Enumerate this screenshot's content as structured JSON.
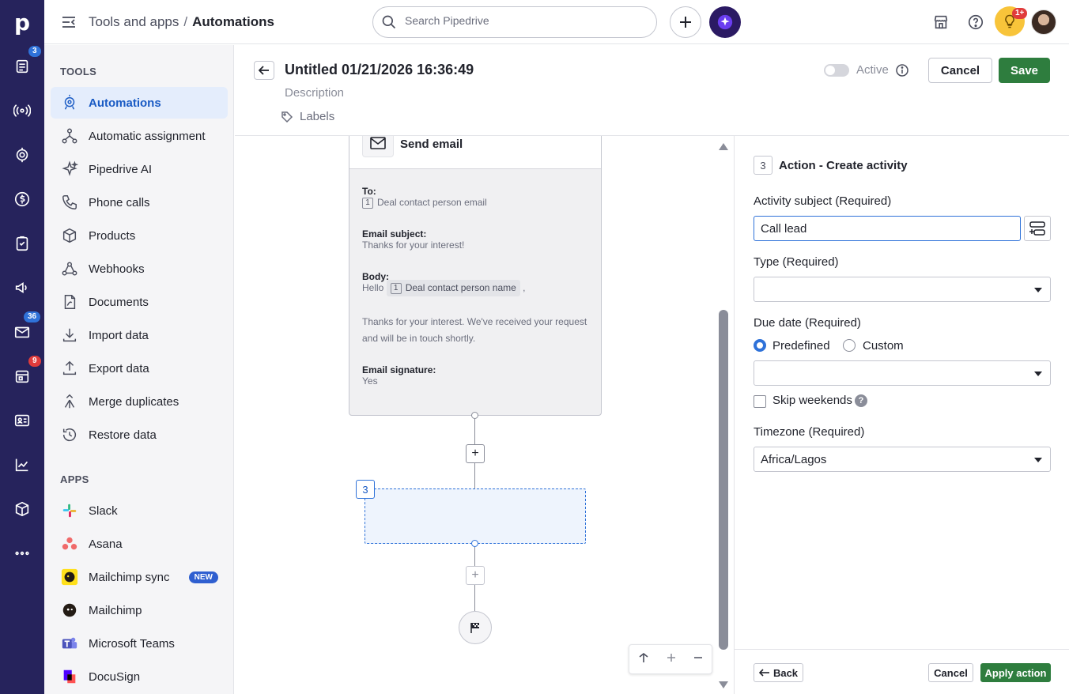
{
  "rail": {
    "logo": "p",
    "badges": {
      "leads": "3",
      "mail": "36",
      "calendar": "9"
    }
  },
  "topbar": {
    "breadcrumb_parent": "Tools and apps",
    "breadcrumb_separator": "/",
    "breadcrumb_current": "Automations",
    "search_placeholder": "Search Pipedrive",
    "notification_badge": "1+"
  },
  "sidebar": {
    "tools_heading": "TOOLS",
    "tools": [
      {
        "label": "Automations",
        "icon": "automations-icon",
        "active": true
      },
      {
        "label": "Automatic assignment",
        "icon": "assignment-icon"
      },
      {
        "label": "Pipedrive AI",
        "icon": "sparkle-icon"
      },
      {
        "label": "Phone calls",
        "icon": "phone-icon"
      },
      {
        "label": "Products",
        "icon": "box-icon"
      },
      {
        "label": "Webhooks",
        "icon": "webhook-icon"
      },
      {
        "label": "Documents",
        "icon": "document-icon"
      },
      {
        "label": "Import data",
        "icon": "import-icon"
      },
      {
        "label": "Export data",
        "icon": "export-icon"
      },
      {
        "label": "Merge duplicates",
        "icon": "merge-icon"
      },
      {
        "label": "Restore data",
        "icon": "restore-icon"
      }
    ],
    "apps_heading": "APPS",
    "apps": [
      {
        "label": "Slack",
        "icon": "slack-icon"
      },
      {
        "label": "Asana",
        "icon": "asana-icon"
      },
      {
        "label": "Mailchimp sync",
        "icon": "mailchimp-icon",
        "badge": "NEW"
      },
      {
        "label": "Mailchimp",
        "icon": "mailchimp-icon"
      },
      {
        "label": "Microsoft Teams",
        "icon": "teams-icon"
      },
      {
        "label": "DocuSign",
        "icon": "docusign-icon"
      }
    ]
  },
  "editor": {
    "title": "Untitled 01/21/2026 16:36:49",
    "description_placeholder": "Description",
    "labels": "Labels",
    "active_label": "Active",
    "cancel": "Cancel",
    "save": "Save"
  },
  "canvas": {
    "email_card": {
      "title": "Send email",
      "to_label": "To:",
      "to_step": "1",
      "to_value": "Deal contact person email",
      "subject_label": "Email subject:",
      "subject_value": "Thanks for your interest!",
      "body_label": "Body:",
      "body_greeting": "Hello",
      "body_step": "1",
      "body_token": "Deal contact person name",
      "body_comma": ",",
      "body_text": "Thanks for your interest. We've received your request and will be in touch shortly.",
      "signature_label": "Email signature:",
      "signature_value": "Yes"
    },
    "new_step_number": "3"
  },
  "panel": {
    "step_number": "3",
    "title": "Action - Create activity",
    "subject_label": "Activity subject (Required)",
    "subject_value": "Call lead",
    "type_label": "Type (Required)",
    "type_value": "",
    "due_label": "Due date (Required)",
    "due_options": [
      "Predefined",
      "Custom"
    ],
    "due_selected": "Predefined",
    "due_value": "",
    "skip_weekends": "Skip weekends",
    "skip_help": "?",
    "timezone_label": "Timezone (Required)",
    "timezone_value": "Africa/Lagos",
    "back": "Back",
    "cancel": "Cancel",
    "apply": "Apply action"
  },
  "colors": {
    "rail_bg": "#26235c",
    "accent_blue": "#2f72d9",
    "save_green": "#2e7d3e",
    "active_bg": "#e4edfc"
  }
}
